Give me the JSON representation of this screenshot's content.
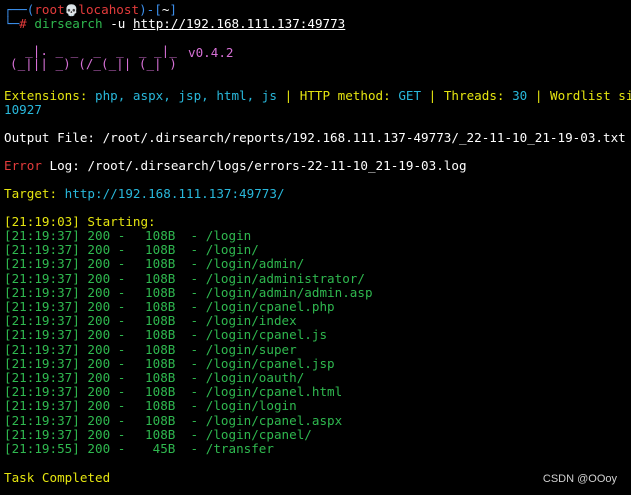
{
  "prompt": {
    "top_bracket": "┌──(",
    "user": "root",
    "skull": "💀",
    "host": "locahost",
    "mid": ")-[",
    "dir": "~",
    "end": "]",
    "bottom_bracket": "└─",
    "symbol": "#",
    "command": "dirsearch",
    "flag": "-u",
    "url": "http://192.168.111.137:49773"
  },
  "banner": {
    "logo_line1": "  _|. _ _  _  _  _ _|_",
    "logo_line2": "(_||| _) (/_(_|| (_| )",
    "version": "v0.4.2"
  },
  "config": {
    "ext_label": "Extensions:",
    "ext_value": "php, aspx, jsp, html, js",
    "sep": " | ",
    "method_label": "HTTP method:",
    "method_value": "GET",
    "threads_label": "Threads:",
    "threads_value": "30",
    "wordlist_label": "Wordlist size:",
    "wordlist_value": "10927"
  },
  "output_file": {
    "label": "Output File:",
    "value": "/root/.dirsearch/reports/192.168.111.137-49773/_22-11-10_21-19-03.txt"
  },
  "error_log": {
    "label1": "Error",
    "label2": " Log:",
    "value": "/root/.dirsearch/logs/errors-22-11-10_21-19-03.log"
  },
  "target": {
    "label": "Target:",
    "value": "http://192.168.111.137:49773/"
  },
  "starting": "[21:19:03] Starting:",
  "results": [
    {
      "time": "[21:19:37]",
      "status": "200",
      "size": "108B",
      "path": "/login"
    },
    {
      "time": "[21:19:37]",
      "status": "200",
      "size": "108B",
      "path": "/login/"
    },
    {
      "time": "[21:19:37]",
      "status": "200",
      "size": "108B",
      "path": "/login/admin/"
    },
    {
      "time": "[21:19:37]",
      "status": "200",
      "size": "108B",
      "path": "/login/administrator/"
    },
    {
      "time": "[21:19:37]",
      "status": "200",
      "size": "108B",
      "path": "/login/admin/admin.asp"
    },
    {
      "time": "[21:19:37]",
      "status": "200",
      "size": "108B",
      "path": "/login/cpanel.php"
    },
    {
      "time": "[21:19:37]",
      "status": "200",
      "size": "108B",
      "path": "/login/index"
    },
    {
      "time": "[21:19:37]",
      "status": "200",
      "size": "108B",
      "path": "/login/cpanel.js"
    },
    {
      "time": "[21:19:37]",
      "status": "200",
      "size": "108B",
      "path": "/login/super"
    },
    {
      "time": "[21:19:37]",
      "status": "200",
      "size": "108B",
      "path": "/login/cpanel.jsp"
    },
    {
      "time": "[21:19:37]",
      "status": "200",
      "size": "108B",
      "path": "/login/oauth/"
    },
    {
      "time": "[21:19:37]",
      "status": "200",
      "size": "108B",
      "path": "/login/cpanel.html"
    },
    {
      "time": "[21:19:37]",
      "status": "200",
      "size": "108B",
      "path": "/login/login"
    },
    {
      "time": "[21:19:37]",
      "status": "200",
      "size": "108B",
      "path": "/login/cpanel.aspx"
    },
    {
      "time": "[21:19:37]",
      "status": "200",
      "size": "108B",
      "path": "/login/cpanel/"
    },
    {
      "time": "[21:19:55]",
      "status": "200",
      "size": "45B",
      "path": "/transfer"
    }
  ],
  "task_completed": "Task Completed",
  "watermark": "CSDN @OOoy",
  "colors": {
    "background": "#000000",
    "prompt_blue": "#3b8eea",
    "user_red": "#e33b3b",
    "banner_magenta": "#d670d6",
    "label_yellow": "#e5e510",
    "value_cyan": "#29b8db",
    "result_green": "#2fb84f"
  }
}
